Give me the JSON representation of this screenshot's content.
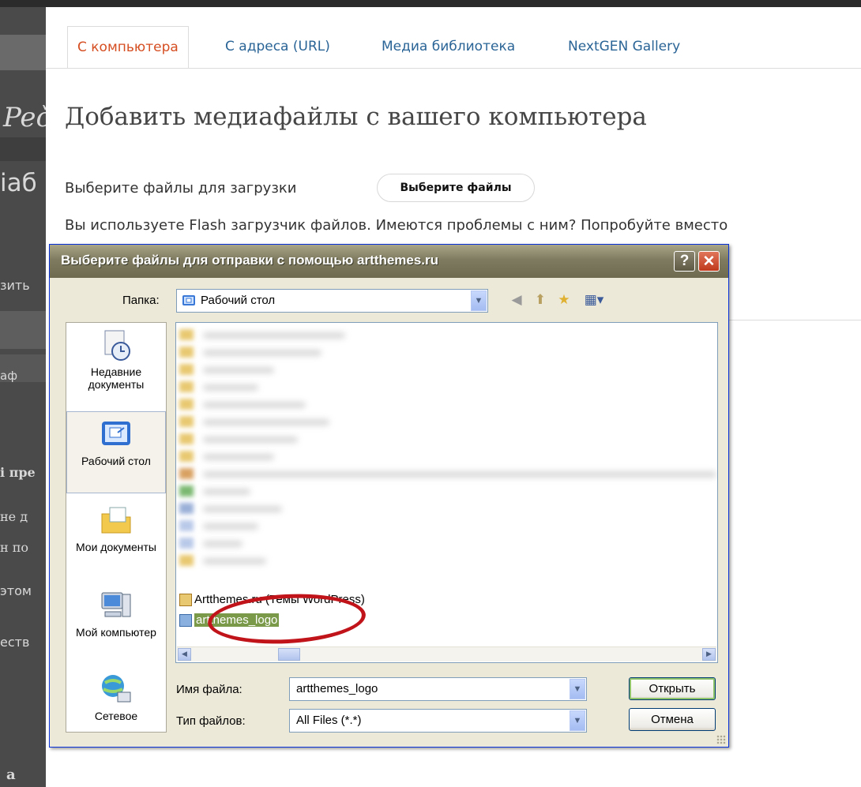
{
  "background": {
    "tabs": [
      {
        "label": "С компьютера",
        "active": true
      },
      {
        "label": "С адреса (URL)",
        "active": false
      },
      {
        "label": "Медиа библиотека",
        "active": false
      },
      {
        "label": "NextGEN Gallery",
        "active": false
      }
    ],
    "heading": "Добавить медиафайлы с вашего компьютера",
    "choose_label": "Выберите файлы для загрузки",
    "choose_button": "Выберите файлы",
    "flash_note": "Вы используете Flash загрузчик файлов. Имеются проблемы с ним? Попробуйте вместо",
    "left_strip": [
      "Peč",
      "іаб",
      "зить",
      "аф",
      "і пре",
      "не д",
      "н по",
      "этом",
      "еств",
      "а"
    ],
    "accent_color": "#d54e21",
    "link_color": "#2a6496"
  },
  "dialog": {
    "title": "Выберите файлы для отправки с помощью artthemes.ru",
    "folder_label": "Папка:",
    "folder_value": "Рабочий стол",
    "places": [
      {
        "label": "Недавние документы",
        "icon": "recent-documents-icon"
      },
      {
        "label": "Рабочий стол",
        "icon": "desktop-icon",
        "selected": true
      },
      {
        "label": "Мои документы",
        "icon": "my-documents-icon"
      },
      {
        "label": "Мой компьютер",
        "icon": "my-computer-icon"
      },
      {
        "label": "Сетевое",
        "icon": "network-icon"
      }
    ],
    "files": [
      {
        "name": "Artthemes.ru (Темы WordPress)",
        "selected": false
      },
      {
        "name": "artthemes_logo",
        "selected": true
      }
    ],
    "filename_label": "Имя файла:",
    "filename_value": "artthemes_logo",
    "filetype_label": "Тип файлов:",
    "filetype_value": "All Files (*.*)",
    "open_button": "Открыть",
    "cancel_button": "Отмена",
    "help_button": "?",
    "close_button": "✕"
  }
}
